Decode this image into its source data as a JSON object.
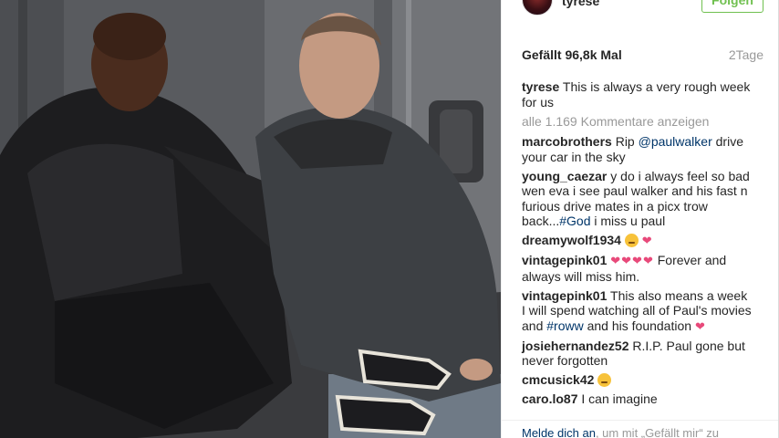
{
  "post": {
    "username": "tyrese",
    "follow_label": "Folgen",
    "likes": "Gefällt 96,8k Mal",
    "age": "2Tage",
    "caption": "This is always a very rough week for us",
    "load_more": "alle 1.169 Kommentare anzeigen"
  },
  "comments": [
    {
      "user": "marcobrothers",
      "pre": "Rip ",
      "link": "@paulwalker",
      "post": " drive your car in the sky"
    },
    {
      "user": "young_caezar",
      "pre": "y do i always feel so bad wen eva i see paul walker and his fast n furious drive mates in a picx trow back...",
      "link": "#God",
      "post": " i miss u paul"
    },
    {
      "user": "dreamywolf1934",
      "emoji": "😩",
      "hearts": "❤"
    },
    {
      "user": "vintagepink01",
      "hearts": "❤❤❤❤",
      "post": " Forever and always will miss him."
    },
    {
      "user": "vintagepink01",
      "pre": "This also means a week I will spend watching all of Paul's movies and ",
      "link": "#roww",
      "post": " and his foundation",
      "hearts": "❤"
    },
    {
      "user": "josiehernandez52",
      "pre": "R.I.P. Paul gone but never forgotten"
    },
    {
      "user": "cmcusick42",
      "emoji": "😘"
    },
    {
      "user": "caro.lo87",
      "pre": "I can imagine"
    }
  ],
  "footer": {
    "login_link": "Melde dich an",
    "login_rest": ", um mit „Gefällt mir“ zu"
  },
  "colors": {
    "accent": "#70c050",
    "link": "#003569",
    "heart": "#e8497a"
  }
}
